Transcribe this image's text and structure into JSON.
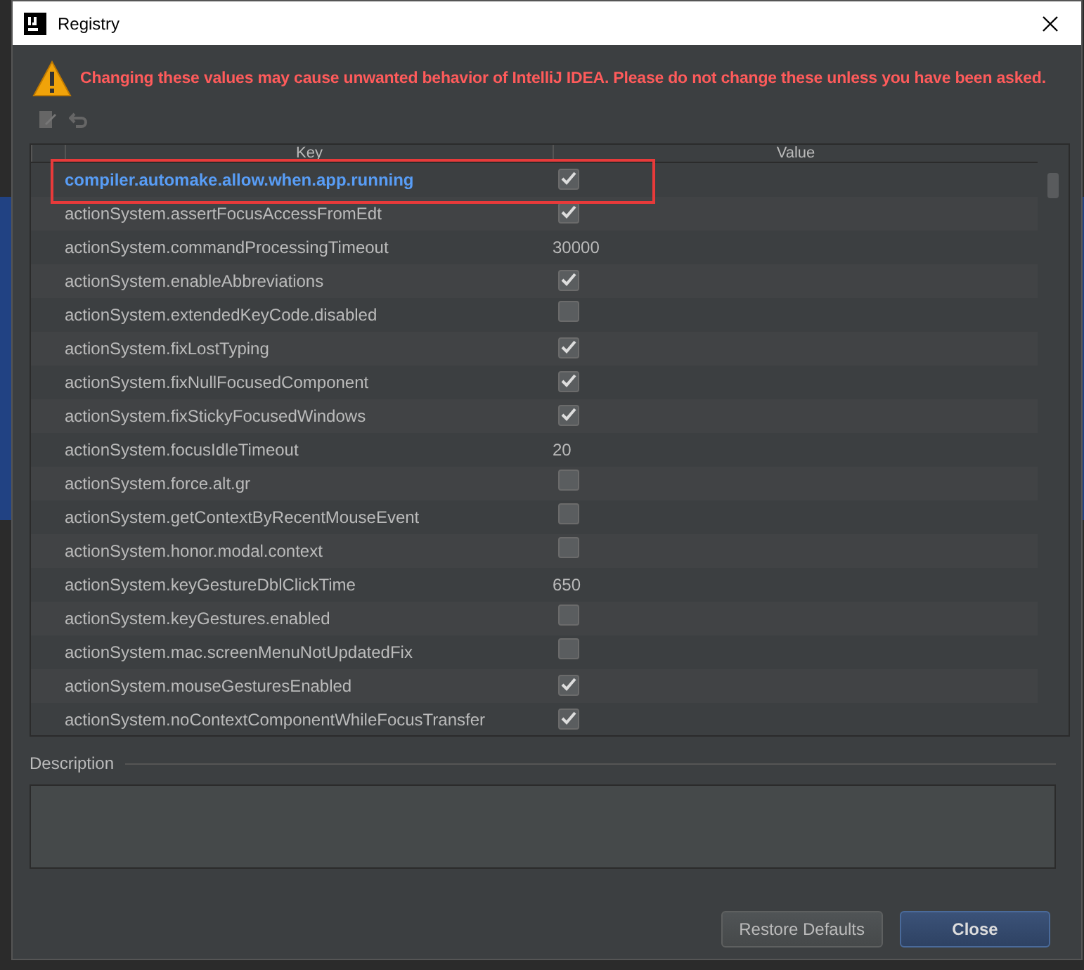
{
  "window": {
    "title": "Registry"
  },
  "warning": "Changing these values may cause unwanted behavior of IntelliJ IDEA. Please do not change these unless you have been asked.",
  "table": {
    "columns": [
      "Key",
      "Value"
    ],
    "rows": [
      {
        "key": "compiler.automake.allow.when.app.running",
        "kind": "check",
        "checked": true,
        "selected": true,
        "highlighted": true
      },
      {
        "key": "actionSystem.assertFocusAccessFromEdt",
        "kind": "check",
        "checked": true,
        "selected": false
      },
      {
        "key": "actionSystem.commandProcessingTimeout",
        "kind": "text",
        "value": "30000",
        "selected": false
      },
      {
        "key": "actionSystem.enableAbbreviations",
        "kind": "check",
        "checked": true,
        "selected": false
      },
      {
        "key": "actionSystem.extendedKeyCode.disabled",
        "kind": "check",
        "checked": false,
        "selected": false
      },
      {
        "key": "actionSystem.fixLostTyping",
        "kind": "check",
        "checked": true,
        "selected": false
      },
      {
        "key": "actionSystem.fixNullFocusedComponent",
        "kind": "check",
        "checked": true,
        "selected": false
      },
      {
        "key": "actionSystem.fixStickyFocusedWindows",
        "kind": "check",
        "checked": true,
        "selected": false
      },
      {
        "key": "actionSystem.focusIdleTimeout",
        "kind": "text",
        "value": "20",
        "selected": false
      },
      {
        "key": "actionSystem.force.alt.gr",
        "kind": "check",
        "checked": false,
        "selected": false
      },
      {
        "key": "actionSystem.getContextByRecentMouseEvent",
        "kind": "check",
        "checked": false,
        "selected": false
      },
      {
        "key": "actionSystem.honor.modal.context",
        "kind": "check",
        "checked": false,
        "selected": false
      },
      {
        "key": "actionSystem.keyGestureDblClickTime",
        "kind": "text",
        "value": "650",
        "selected": false
      },
      {
        "key": "actionSystem.keyGestures.enabled",
        "kind": "check",
        "checked": false,
        "selected": false
      },
      {
        "key": "actionSystem.mac.screenMenuNotUpdatedFix",
        "kind": "check",
        "checked": false,
        "selected": false
      },
      {
        "key": "actionSystem.mouseGesturesEnabled",
        "kind": "check",
        "checked": true,
        "selected": false
      },
      {
        "key": "actionSystem.noContextComponentWhileFocusTransfer",
        "kind": "check",
        "checked": true,
        "selected": false
      }
    ]
  },
  "description": {
    "label": "Description"
  },
  "buttons": [
    {
      "label": "Restore Defaults",
      "default": false
    },
    {
      "label": "Close",
      "default": true
    }
  ]
}
